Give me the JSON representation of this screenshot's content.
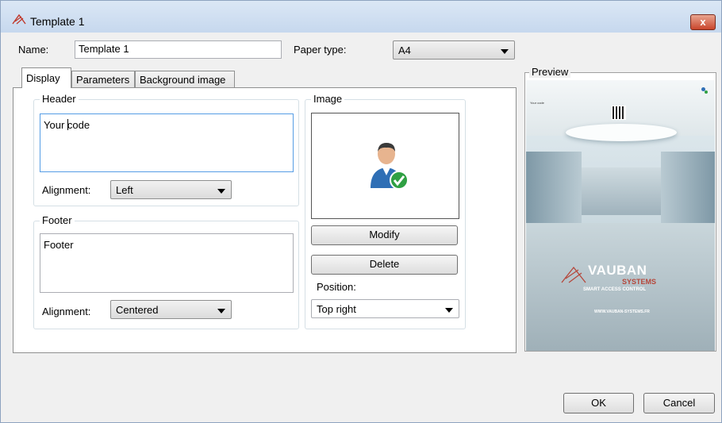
{
  "window": {
    "title": "Template 1",
    "close_glyph": "x",
    "icon": "vauban-logo-icon"
  },
  "name_field": {
    "label": "Name:",
    "value": "Template 1"
  },
  "paper_type": {
    "label": "Paper type:",
    "value": "A4"
  },
  "tabs": [
    {
      "label": "Display",
      "active": true
    },
    {
      "label": "Parameters",
      "active": false
    },
    {
      "label": "Background image",
      "active": false
    }
  ],
  "header_group": {
    "title": "Header",
    "text": "Your code",
    "alignment_label": "Alignment:",
    "alignment_value": "Left"
  },
  "footer_group": {
    "title": "Footer",
    "text": "Footer",
    "alignment_label": "Alignment:",
    "alignment_value": "Centered"
  },
  "image_group": {
    "title": "Image",
    "image_icon": "user-check-icon",
    "modify_label": "Modify",
    "delete_label": "Delete",
    "position_label": "Position:",
    "position_value": "Top right"
  },
  "preview": {
    "title": "Preview",
    "header_text": "Your code",
    "logo_line1": "VAUBAN",
    "logo_line2": "SYSTEMS",
    "logo_tagline": "SMART ACCESS CONTROL",
    "website": "WWW.VAUBAN-SYSTEMS.FR"
  },
  "buttons": {
    "ok_label": "OK",
    "cancel_label": "Cancel"
  },
  "colors": {
    "accent": "#569de5",
    "brand_red": "#b5463a",
    "check_green": "#2fa043"
  }
}
